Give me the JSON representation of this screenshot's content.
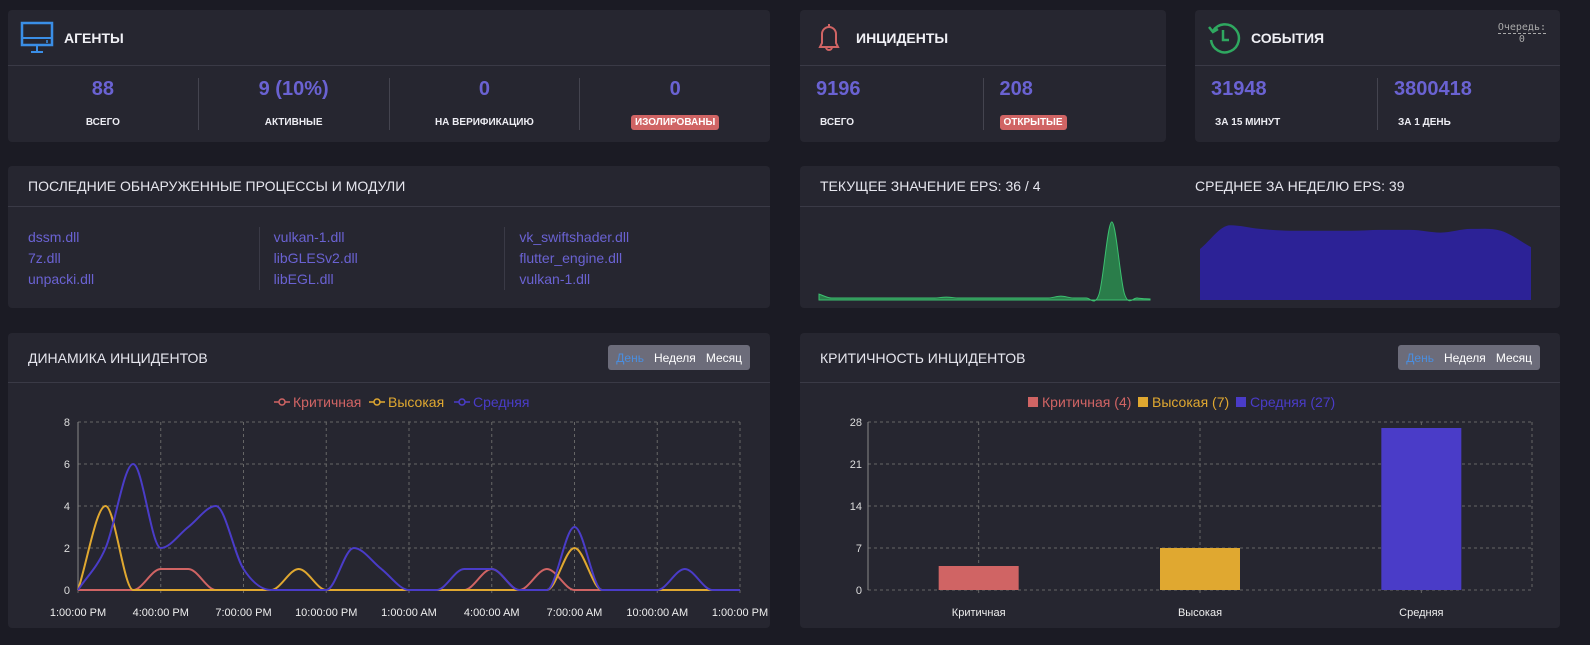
{
  "agents": {
    "title": "АГЕНТЫ",
    "icon": "monitor-icon",
    "stats": [
      {
        "value": "88",
        "label": "ВСЕГО"
      },
      {
        "value": "9 (10%)",
        "label": "АКТИВНЫЕ"
      },
      {
        "value": "0",
        "label": "НА ВЕРИФИКАЦИЮ"
      },
      {
        "value": "0",
        "label": "ИЗОЛИРОВАНЫ",
        "badge": true
      }
    ]
  },
  "incidents": {
    "title": "ИНЦИДЕНТЫ",
    "icon": "bell-icon",
    "stats": [
      {
        "value": "9196",
        "label": "ВСЕГО"
      },
      {
        "value": "208",
        "label": "ОТКРЫТЫЕ",
        "badge": true
      }
    ]
  },
  "events": {
    "title": "СОБЫТИЯ",
    "icon": "history-icon",
    "queue_label": "Очередь:",
    "queue_value": "0",
    "stats": [
      {
        "value": "31948",
        "label": "ЗА 15 МИНУТ"
      },
      {
        "value": "3800418",
        "label": "ЗА 1 ДЕНЬ"
      }
    ]
  },
  "processes": {
    "title": "ПОСЛЕДНИЕ ОБНАРУЖЕННЫЕ ПРОЦЕССЫ И МОДУЛИ",
    "columns": [
      [
        "dssm.dll",
        "7z.dll",
        "unpacki.dll"
      ],
      [
        "vulkan-1.dll",
        "libGLESv2.dll",
        "libEGL.dll"
      ],
      [
        "vk_swiftshader.dll",
        "flutter_engine.dll",
        "vulkan-1.dll"
      ]
    ]
  },
  "eps": {
    "current_label": "ТЕКУЩЕЕ ЗНАЧЕНИЕ EPS: 36 / 4",
    "week_label": "СРЕДНЕЕ ЗА НЕДЕЛЮ EPS: 39"
  },
  "range_buttons": [
    "День",
    "Неделя",
    "Месяц"
  ],
  "colors": {
    "critical": "#d06464",
    "high": "#e0a830",
    "medium": "#4a3cc8",
    "accent": "#6a62d2",
    "eps_current": "#2a7d4a",
    "eps_week": "#2c2296"
  },
  "chart_data": [
    {
      "type": "line",
      "title": "ДИНАМИКА ИНЦИДЕНТОВ",
      "ylim": [
        0,
        8
      ],
      "yticks": [
        0,
        2,
        4,
        6,
        8
      ],
      "xticks": [
        "1:00:00 PM",
        "4:00:00 PM",
        "7:00:00 PM",
        "10:00:00 PM",
        "1:00:00 AM",
        "4:00:00 AM",
        "7:00:00 AM",
        "10:00:00 AM",
        "1:00:00 PM"
      ],
      "x_step": "1 hour",
      "grid": true,
      "legend": "top",
      "series": [
        {
          "name": "Критичная",
          "color": "#d06464",
          "values": [
            0,
            0,
            0,
            1,
            1,
            0,
            0,
            0,
            0,
            0,
            0,
            0,
            0,
            0,
            0,
            1,
            0,
            1,
            0,
            0,
            0,
            0,
            0,
            0,
            0
          ]
        },
        {
          "name": "Высокая",
          "color": "#e0a830",
          "values": [
            0,
            4,
            0,
            0,
            0,
            0,
            0,
            0,
            1,
            0,
            0,
            0,
            0,
            0,
            0,
            0,
            0,
            0,
            2,
            0,
            0,
            0,
            0,
            0,
            0
          ]
        },
        {
          "name": "Средняя",
          "color": "#4a3cc8",
          "values": [
            0,
            2,
            6,
            2,
            3,
            4,
            1,
            0,
            0,
            0,
            2,
            1,
            0,
            0,
            1,
            1,
            0,
            0,
            3,
            0,
            0,
            0,
            1,
            0,
            0
          ]
        }
      ]
    },
    {
      "type": "bar",
      "title": "КРИТИЧНОСТЬ ИНЦИДЕНТОВ",
      "ylim": [
        0,
        28
      ],
      "yticks": [
        0,
        7,
        14,
        21,
        28
      ],
      "grid": true,
      "legend": "top",
      "categories": [
        "Критичная",
        "Высокая",
        "Средняя"
      ],
      "values": [
        4,
        7,
        27
      ],
      "legend_labels": [
        "Критичная (4)",
        "Высокая (7)",
        "Средняя (27)"
      ],
      "colors": [
        "#d06464",
        "#e0a830",
        "#4a3cc8"
      ]
    },
    {
      "type": "area",
      "name": "eps-current",
      "values": [
        3,
        1,
        1,
        1,
        1,
        1,
        1,
        1,
        1,
        1,
        1.5,
        1,
        1,
        1,
        1,
        1,
        1,
        1,
        1,
        2,
        1,
        1,
        3,
        40,
        3,
        1,
        0.5
      ]
    },
    {
      "type": "area",
      "name": "eps-week",
      "values": [
        56,
        82,
        78,
        76,
        76,
        76,
        77,
        77,
        74,
        78,
        76,
        58
      ]
    }
  ]
}
